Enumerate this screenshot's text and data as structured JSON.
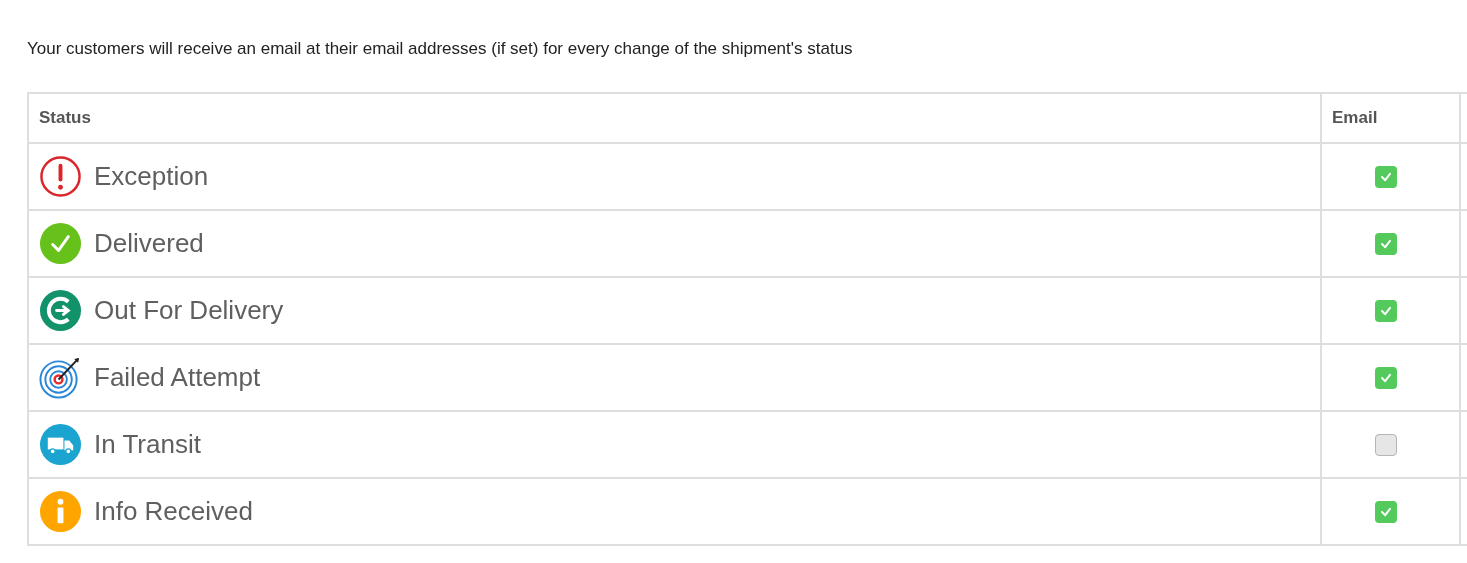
{
  "intro": "Your customers will receive an email at their email addresses (if set) for every change of the shipment's status",
  "table": {
    "columns": [
      "Status",
      "Email"
    ],
    "rows": [
      {
        "kind": "exception",
        "status": "Exception",
        "email": true
      },
      {
        "kind": "delivered",
        "status": "Delivered",
        "email": true
      },
      {
        "kind": "out_for_delivery",
        "status": "Out For Delivery",
        "email": true
      },
      {
        "kind": "failed_attempt",
        "status": "Failed Attempt",
        "email": true
      },
      {
        "kind": "in_transit",
        "status": "In Transit",
        "email": false
      },
      {
        "kind": "info_received",
        "status": "Info Received",
        "email": true
      }
    ]
  }
}
